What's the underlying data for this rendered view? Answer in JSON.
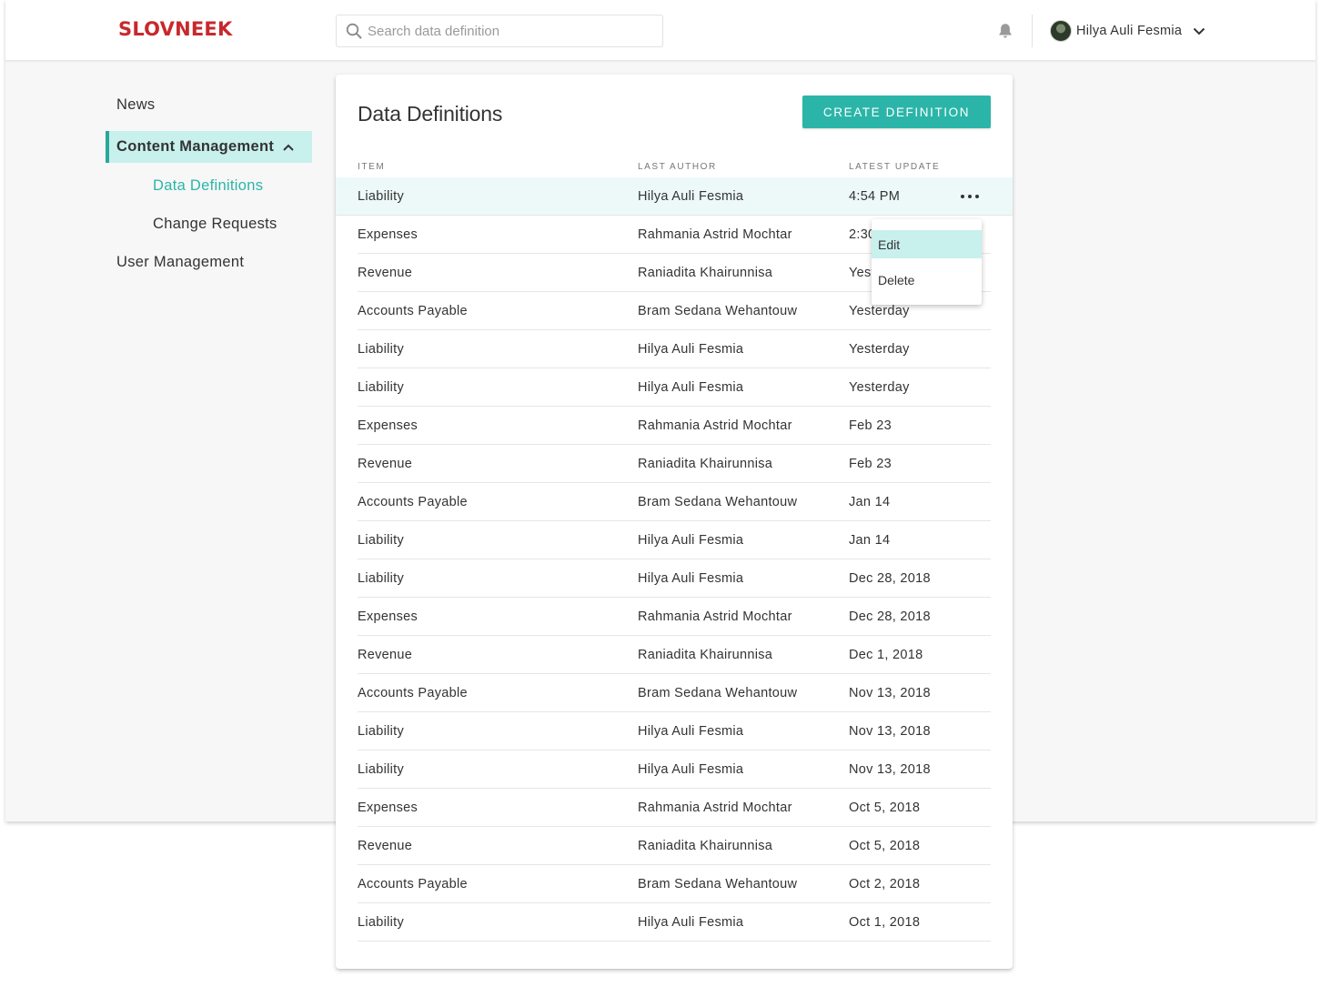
{
  "app": {
    "brand": "SLOVNEEK",
    "brand_color": "#c8282d",
    "accent_color": "#2bb5a9"
  },
  "search": {
    "placeholder": "Search data definition"
  },
  "header": {
    "user_name": "Hilya Auli Fesmia"
  },
  "icons": {
    "search": "search-icon",
    "bell": "bell-icon",
    "chevron": "chevron-down-icon",
    "collapse": "chevron-up-icon",
    "more": "more-horizontal-icon"
  },
  "sidebar": {
    "items": [
      {
        "label": "News"
      },
      {
        "label": "Content Management"
      },
      {
        "label": "Data Definitions"
      },
      {
        "label": "Change Requests"
      },
      {
        "label": "User Management"
      }
    ]
  },
  "main": {
    "title": "Data Definitions",
    "create_button": "CREATE DEFINITION",
    "columns": [
      "ITEM",
      "LAST AUTHOR",
      "LATEST UPDATE"
    ],
    "rows": [
      {
        "item": "Liability",
        "author": "Hilya Auli Fesmia",
        "update": "4:54 PM"
      },
      {
        "item": "Expenses",
        "author": "Rahmania Astrid Mochtar",
        "update": "2:30"
      },
      {
        "item": "Revenue",
        "author": "Raniadita Khairunnisa",
        "update": "Yest"
      },
      {
        "item": "Accounts Payable",
        "author": "Bram Sedana Wehantouw",
        "update": "Yesterday"
      },
      {
        "item": "Liability",
        "author": "Hilya Auli Fesmia",
        "update": "Yesterday"
      },
      {
        "item": "Liability",
        "author": "Hilya Auli Fesmia",
        "update": "Yesterday"
      },
      {
        "item": "Expenses",
        "author": "Rahmania Astrid Mochtar",
        "update": "Feb 23"
      },
      {
        "item": "Revenue",
        "author": "Raniadita Khairunnisa",
        "update": "Feb 23"
      },
      {
        "item": "Accounts Payable",
        "author": "Bram Sedana Wehantouw",
        "update": "Jan 14"
      },
      {
        "item": "Liability",
        "author": "Hilya Auli Fesmia",
        "update": "Jan 14"
      },
      {
        "item": "Liability",
        "author": "Hilya Auli Fesmia",
        "update": "Dec 28, 2018"
      },
      {
        "item": "Expenses",
        "author": "Rahmania Astrid Mochtar",
        "update": "Dec 28, 2018"
      },
      {
        "item": "Revenue",
        "author": "Raniadita Khairunnisa",
        "update": "Dec 1, 2018"
      },
      {
        "item": "Accounts Payable",
        "author": "Bram Sedana Wehantouw",
        "update": "Nov 13, 2018"
      },
      {
        "item": "Liability",
        "author": "Hilya Auli Fesmia",
        "update": "Nov 13, 2018"
      },
      {
        "item": "Liability",
        "author": "Hilya Auli Fesmia",
        "update": "Nov 13, 2018"
      },
      {
        "item": "Expenses",
        "author": "Rahmania Astrid Mochtar",
        "update": "Oct 5, 2018"
      },
      {
        "item": "Revenue",
        "author": "Raniadita Khairunnisa",
        "update": "Oct 5, 2018"
      },
      {
        "item": "Accounts Payable",
        "author": "Bram Sedana Wehantouw",
        "update": "Oct 2, 2018"
      },
      {
        "item": "Liability",
        "author": "Hilya Auli Fesmia",
        "update": "Oct 1, 2018"
      }
    ]
  },
  "context_menu": {
    "items": [
      {
        "label": "Edit"
      },
      {
        "label": "Delete"
      }
    ]
  }
}
